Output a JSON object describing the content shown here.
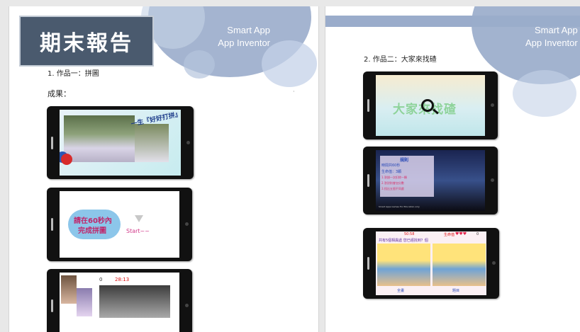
{
  "left_page": {
    "brand_line1": "Smart App",
    "brand_line2": "App Inventor",
    "title": "期末報告",
    "item1": "1.  作品一：拼圖",
    "result_label": "成果：",
    "screen1_banner": "一生『好好打拼』",
    "screen2_text_line1": "請在60秒內",
    "screen2_text_line2": "完成拼圖",
    "screen2_start": "Start~~",
    "screen3_zero": "0",
    "screen3_time": "28:13"
  },
  "right_page": {
    "brand_line1": "Smart App",
    "brand_line2": "App Inventor",
    "item2": "2.  作品二：大家來找碴",
    "screen1_title": "大家來找碴",
    "screen2_rules_title": "規則",
    "screen2_rules_lines": [
      "時間共60秒",
      "生命值：3顆",
      "1.答錯一次扣除一顆",
      "2.答對則會加分數",
      "3.找出五個不同處"
    ],
    "screen2_footer": "Smart Apps Games For Education only",
    "screen3_timer": "50:58",
    "screen3_lives_label": "生命值",
    "screen3_hearts": "♥♥♥",
    "screen3_score": "0",
    "screen3_prompt": "共有5個相異處 您已經找到？個",
    "screen3_left_label": "全畫",
    "screen3_right_label": "題目"
  },
  "colors": {
    "title_bg": "#4a5a6e",
    "circle_blue": "#9aaccb",
    "page_bg": "#ffffff",
    "canvas_bg": "#e8e8e8"
  }
}
